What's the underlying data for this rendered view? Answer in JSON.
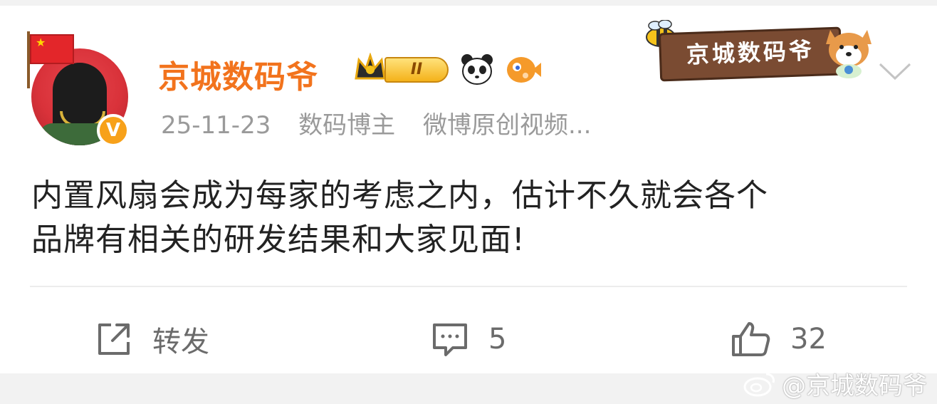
{
  "post": {
    "username": "京城数码爷",
    "level_badge": "II",
    "date": "25-11-23",
    "tag1": "数码博主",
    "tag2": "微博原创视频...",
    "content_line1": "内置风扇会成为每家的考虑之内，估计不久就会各个",
    "content_line2": "品牌有相关的研发结果和大家见面!",
    "sign_text": "京城数码爷",
    "verified_mark": "V"
  },
  "actions": {
    "repost_label": "转发",
    "comment_count": "5",
    "like_count": "32"
  },
  "watermark": {
    "text": "@京城数码爷"
  },
  "colors": {
    "username": "#f2731d",
    "text": "#222222",
    "meta": "#9a9a9a",
    "action": "#6b6b6b"
  }
}
